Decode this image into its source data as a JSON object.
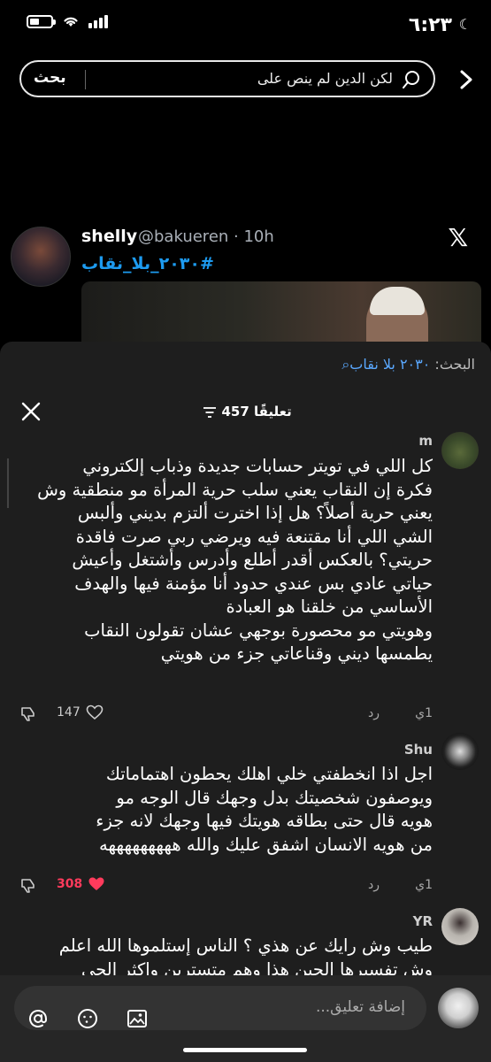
{
  "status": {
    "time": "٦:٢٣"
  },
  "search": {
    "query": "لكن الدين لم ينص على",
    "submit_label": "بحث"
  },
  "tweet": {
    "name": "shelly",
    "handle": "@bakueren · 10h",
    "hashtag": "#٢٠٣٠_بلا_نقاب"
  },
  "sheet": {
    "related_label": "البحث:",
    "related_query": "٢٠٣٠ بلا نقاب",
    "count_label": "457 تعليقًا"
  },
  "comments": [
    {
      "user": "m",
      "lines": [
        "كل اللي في تويتر حسابات جديدة وذباب إلكتروني",
        "فكرة إن النقاب يعني سلب حرية المرأة مو منطقية وش",
        "يعني حرية أصلاً؟ هل إذا اخترت ألتزم بديني وألبس",
        "الشي اللي أنا مقتنعة فيه ويرضي ربي صرت فاقدة",
        "حريتي؟ بالعكس أقدر أطلع وأدرس وأشتغل وأعيش",
        "حياتي عادي بس عندي حدود أنا مؤمنة فيها والهدف",
        "الأساسي من خلقنا هو العبادة",
        "وهويتي مو محصورة بوجهي عشان تقولون النقاب",
        "يطمسها ديني وقناعاتي جزء من هويتي"
      ],
      "age": "1ي",
      "reply": "رد",
      "likes": "147"
    },
    {
      "user": "Shu",
      "lines": [
        "اجل اذا انخطفتي خلي اهلك يحطون اهتماماتك",
        "ويوصفون شخصيتك بدل وجهك قال الوجه مو",
        "هويه قال حتى بطاقه هويتك فيها وجهك لانه جزء",
        "من هويه الانسان اشفق عليك والله هههههههههه"
      ],
      "age": "1ي",
      "reply": "رد",
      "likes": "308"
    },
    {
      "user": "YR",
      "lines": [
        "طيب وش رايك عن هذي ؟ الناس إستلموها الله اعلم",
        "وش تفسيرها الجين هذا وهم متسترين واكثر الجي"
      ]
    }
  ],
  "composer": {
    "placeholder": "إضافة تعليق..."
  }
}
